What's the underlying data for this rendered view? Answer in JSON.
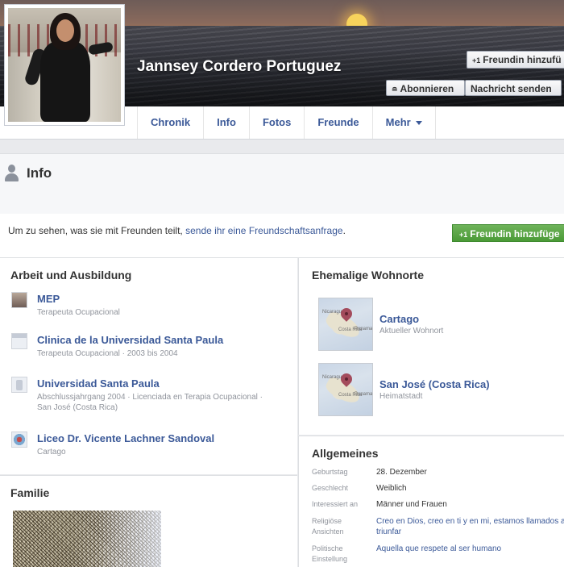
{
  "profile": {
    "name": "Jannsey Cordero Portuguez"
  },
  "actions": {
    "add_friend": "Freundin hinzufü",
    "subscribe": "Abonnieren",
    "message": "Nachricht senden",
    "add_friend_full": "Freundin hinzufüge"
  },
  "tabs": [
    "Chronik",
    "Info",
    "Fotos",
    "Freunde",
    "Mehr"
  ],
  "info": {
    "title": "Info",
    "notice_text": "Um zu sehen, was sie mit Freunden teilt, ",
    "notice_link": "sende ihr eine Freundschaftsanfrage",
    "notice_end": "."
  },
  "work": {
    "title": "Arbeit und Ausbildung",
    "items": [
      {
        "name": "MEP",
        "sub": "Terapeuta Ocupacional"
      },
      {
        "name": "Clinica de la Universidad Santa Paula",
        "sub": "Terapeuta Ocupacional · 2003 bis 2004"
      },
      {
        "name": "Universidad Santa Paula",
        "sub": "Abschlussjahrgang 2004 · Licenciada en Terapia Ocupacional · San José (Costa Rica)"
      },
      {
        "name": "Liceo Dr. Vicente Lachner Sandoval",
        "sub": "Cartago"
      }
    ]
  },
  "family": {
    "title": "Familie"
  },
  "places": {
    "title": "Ehemalige Wohnorte",
    "items": [
      {
        "name": "Cartago",
        "sub": "Aktueller Wohnort"
      },
      {
        "name": "San José (Costa Rica)",
        "sub": "Heimatstadt"
      }
    ],
    "map_labels": [
      "Nicaragua",
      "Costa Rica",
      "Panama"
    ]
  },
  "general": {
    "title": "Allgemeines",
    "rows": [
      {
        "key": "Geburtstag",
        "value": "28. Dezember"
      },
      {
        "key": "Geschlecht",
        "value": "Weiblich"
      },
      {
        "key": "Interessiert an",
        "value": "Männer und Frauen"
      },
      {
        "key": "Religiöse Ansichten",
        "value": "Creo en Dios, creo en ti y en mi, estamos llamados a triunfar"
      },
      {
        "key": "Politische Einstellung",
        "value": "Aquella que respete al ser humano"
      }
    ]
  },
  "colors": {
    "link": "#3b5998",
    "green_button": "#4a9a36",
    "page_bg": "#e9eaed"
  }
}
